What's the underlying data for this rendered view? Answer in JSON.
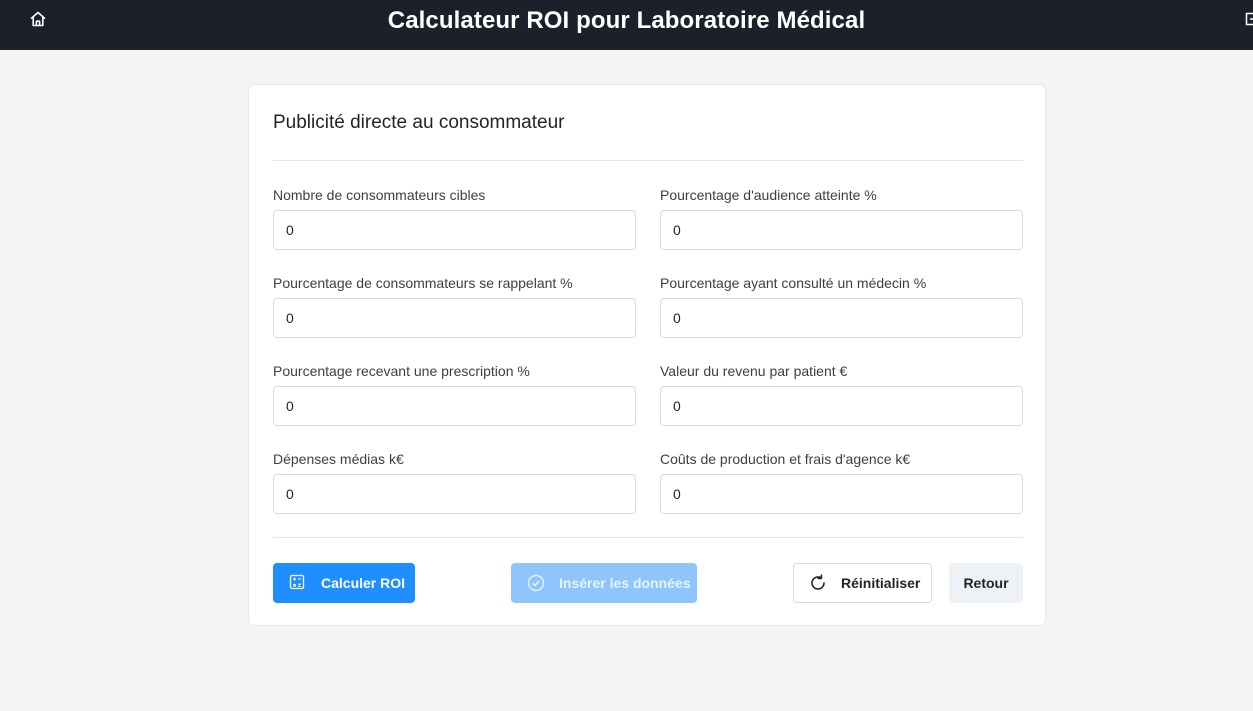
{
  "header": {
    "title": "Calculateur ROI pour Laboratoire Médical",
    "home_icon": "home-icon",
    "logout_icon": "logout-icon"
  },
  "card": {
    "title": "Publicité directe au consommateur",
    "fields": [
      {
        "label": "Nombre de consommateurs cibles",
        "value": "0"
      },
      {
        "label": "Pourcentage d'audience atteinte %",
        "value": "0"
      },
      {
        "label": "Pourcentage de consommateurs se rappelant %",
        "value": "0"
      },
      {
        "label": "Pourcentage ayant consulté un médecin %",
        "value": "0"
      },
      {
        "label": "Pourcentage recevant une prescription %",
        "value": "0"
      },
      {
        "label": "Valeur du revenu par patient €",
        "value": "0"
      },
      {
        "label": "Dépenses médias k€",
        "value": "0"
      },
      {
        "label": "Coûts de production et frais d'agence k€",
        "value": "0"
      }
    ]
  },
  "actions": {
    "calculate": {
      "label": "Calculer ROI",
      "icon": "calculator-icon",
      "color": "#1f8fff"
    },
    "insert": {
      "label": "Insérer les données",
      "icon": "check-circle-icon",
      "disabled": true
    },
    "reset": {
      "label": "Réinitialiser",
      "icon": "refresh-icon"
    },
    "back": {
      "label": "Retour"
    }
  },
  "colors": {
    "header_bg": "#1b202b",
    "page_bg": "#f4f4f4",
    "primary": "#1f8fff",
    "primary_disabled": "#8ec6fb"
  }
}
